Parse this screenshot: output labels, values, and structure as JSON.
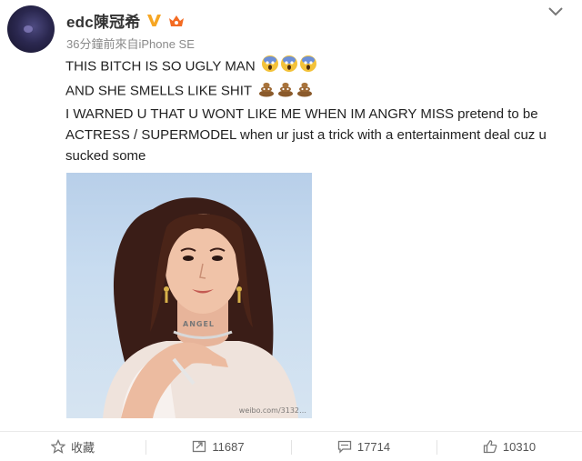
{
  "post": {
    "author": "edc陳冠希",
    "meta": "36分鐘前來自iPhone SE",
    "lines": [
      "THIS BITCH IS SO UGLY MAN",
      "AND SHE SMELLS LIKE SHIT",
      "I WARNED U THAT U WONT LIKE ME WHEN IM ANGRY MISS pretend to be ACTRESS / SUPERMODEL when ur just a trick with a entertainment deal cuz u sucked some"
    ],
    "emoji": [
      "scream-emoji",
      "poop-emoji"
    ],
    "photo_watermark": "weibo.com/3132…",
    "photo_necklace": "ANGEL"
  },
  "actions": {
    "favorite_label": "收藏",
    "repost_count": "11687",
    "comment_count": "17714",
    "like_count": "10310"
  },
  "colors": {
    "verified": "#f6a623",
    "vip": "#f36b22",
    "text": "#222222",
    "meta": "#8a8a8a"
  }
}
